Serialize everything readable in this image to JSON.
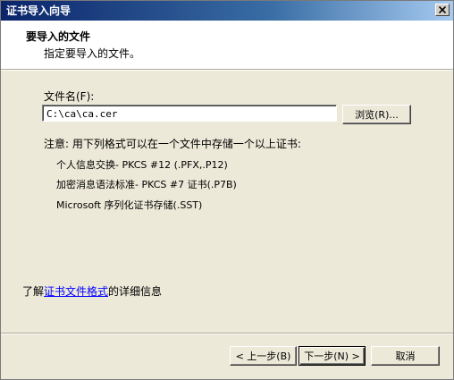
{
  "window": {
    "title": "证书导入向导"
  },
  "header": {
    "title": "要导入的文件",
    "subtitle": "指定要导入的文件。"
  },
  "file": {
    "label": "文件名(F):",
    "value": "C:\\ca\\ca.cer",
    "browse_label": "浏览(R)..."
  },
  "note": {
    "text": "注意: 用下列格式可以在一个文件中存储一个以上证书:",
    "formats": [
      "个人信息交换- PKCS #12 (.PFX,.P12)",
      "加密消息语法标准- PKCS #7 证书(.P7B)",
      "Microsoft 序列化证书存储(.SST)"
    ]
  },
  "learn_more": {
    "prefix": "了解",
    "link": "证书文件格式",
    "suffix": "的详细信息"
  },
  "buttons": {
    "back": "< 上一步(B)",
    "next": "下一步(N) >",
    "cancel": "取消"
  },
  "icons": {
    "close": "close-icon"
  },
  "colors": {
    "dialog_background": "#ece9d8",
    "titlebar_start": "#0a246a",
    "titlebar_end": "#a6caf0",
    "link": "#0000ff"
  }
}
